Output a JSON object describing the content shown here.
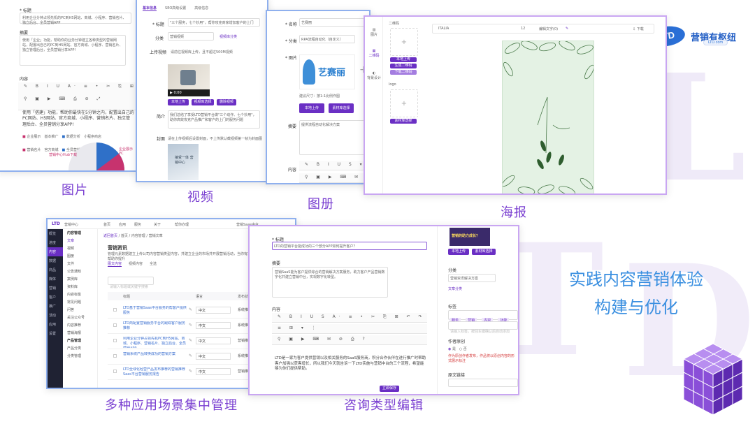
{
  "logo": {
    "mark": "LTD",
    "name": "营销有枢纽",
    "url": "LTD.com"
  },
  "tagline": {
    "line1": "实践内容营销体验",
    "line2": "构建与优化"
  },
  "captions": {
    "image": "图片",
    "video": "视频",
    "album": "图册",
    "poster": "海报",
    "scenarios": "多种应用场景集中管理",
    "consult": "咨询类型编辑"
  },
  "shot_image": {
    "title_label": "* 标题",
    "title_value": "利用企业分钟占领先机的PC到H5网站、商城、小程序、营销名片、独立后台、全员营销APP",
    "summary_label": "摘要",
    "summary_value": "使用「企业」功能，帮助你的业务分钟建立各种类型的营销网站，配置出自己的PC到H5网站、官方商城、小程序、营销名片、独立管理后台，全员营销分享APP!",
    "content_label": "内容",
    "content_value": "使用「搭建」功能，帮助你最快在5分钟之内，配置出自己的PC网站、H5网站、官方商城、小程序、营销名片、独立管理后台、全员营销分享APP!",
    "legend": [
      "企业展示",
      "基本推广",
      "数据分析",
      "小程序商店",
      "营销名片",
      "官方商城",
      "全员营销APP"
    ],
    "chart_label": "营销中心Hub下载",
    "chart_label2": "企业展示 PC"
  },
  "shot_video": {
    "tabs": [
      "基本信息",
      "SEO高级设置",
      "高级信息"
    ],
    "title_label": "* 标题",
    "title_value": "\"三个服务，七个妙用\"，帮你攻克商家增加客户的上门",
    "category_label": "分类",
    "category_value": "营销视频",
    "category_link": "视频库分类",
    "upload_label": "上传视频",
    "upload_hint": "请前往视频库上传，且不超过500M视频",
    "time": "0:00",
    "btn_local": "本地上传",
    "btn_library": "视频库选择",
    "btn_delete": "删除视频",
    "intro_label": "简介",
    "intro_value": "我们总结了享受LTD营销平台做\"三个动作、七个妙用\"，助你高效攻克产品推广和客户的上门的服务问题",
    "cover_label": "封面",
    "cover_hint": "请在上传视频后设置封面，不上传默认截视频第一帧为封面图",
    "thumb_text": "接受一体 营销中心"
  },
  "shot_album": {
    "name_label": "* 名称",
    "name_value": "艺赛丽",
    "category_label": "* 分类",
    "category_value": "RPA流程自动化（自定义）",
    "image_label": "* 图片",
    "logo_text": "艺赛丽",
    "size_hint": "建议尺寸：按1:1比例作图",
    "btn_local": "本地上传",
    "btn_library": "素材库选择",
    "desc_label": "摘要",
    "desc_value": "提供流程自动化解决方案",
    "content_label": "内容"
  },
  "shot_poster": {
    "side_items": [
      "图片",
      "二维码",
      "背景设计"
    ],
    "sub_label": "二维码",
    "logo_label": "logo",
    "btn_local": "本地上传",
    "btn_library": "素材库选择",
    "btn_qr": "生成二维码",
    "btn_download": "下载二维码",
    "font_value": "ITALIA",
    "size_value": "12",
    "font_label": "编辑文字(0)",
    "download_label": "下载"
  },
  "shot_manage": {
    "app_name": "营销中心",
    "nav": [
      "首页",
      "应用",
      "服务",
      "关于",
      "帮你办理"
    ],
    "account": "营销Saas中台",
    "sidebar": [
      "概览",
      "进度",
      "内容",
      "数据",
      "商品",
      "媒体",
      "营销",
      "客户",
      "推广",
      "活动",
      "应用",
      "设置"
    ],
    "subnav": [
      "内容管理",
      "文章",
      "视频",
      "图册",
      "文件",
      "公告通知",
      "案例库",
      "资料库",
      "内容标签",
      "常见问题",
      "问答",
      "关注公众号",
      "内容推荐",
      "营销海报",
      "产品管理",
      "产品分类",
      "分类管理"
    ],
    "breadcrumb": "首页 / 内容管理 / 营销文章",
    "back": "返回首页",
    "page_title": "营销资讯",
    "page_desc": "管理元素数据建立上传公司内容营销类型内容，并建立企业的市场并开展营销活动，当你有意向转化为营销成单时，可以帮助你提升",
    "filter_tabs": [
      "图文内容",
      "视频内容",
      "全选"
    ],
    "search_placeholder": "请输入标题或关键字搜索",
    "col_title": "标题",
    "col_lang": "语言",
    "col_status": "发布状态",
    "rows": [
      {
        "title": "LTD基于营销Saas中台服务的帮客户提供服务",
        "lang": "中文",
        "status": "系统推荐"
      },
      {
        "title": "LTD商配置营销服务平台的跟踪客户服务推荐",
        "lang": "中文",
        "status": "系统推荐"
      },
      {
        "title": "利用企业分钟占领先机PC到H5网站、商城、小程序、营销名片、独立后台、全员营销APP",
        "lang": "中文",
        "status": "营销推荐"
      },
      {
        "title": "营销系统产品转换成功的营销方案",
        "lang": "中文",
        "status": "系统推荐"
      },
      {
        "title": "LTD全球化经营产品发布推荐的营销推荐Saas平台营销服务报告",
        "lang": "中文",
        "status": "营销推荐"
      }
    ]
  },
  "shot_consult": {
    "title_label": "* 标题",
    "title_value": "LTD的营销平台能成功的三个部分APP如何提升客户？",
    "summary_label": "摘要",
    "summary_value": "营销SaaS能为客户提供综合的营销解决方案服务，助力客户产品营销数字化并建立营销中台，实现数字化转型。",
    "content_label": "内容",
    "content_value": "LTD是一家为客户提供营销以及相关服务的SaaS服务商，积分合作伙伴在进行推广时帮助客户加强以获客增长，所以我们今天就告诉一下LTD实施与营销中台的三个流程，希望能够为你们提供帮助。",
    "cover_text": "营销的助力成长？",
    "btn_local": "本地上传",
    "btn_library": "素材库选择",
    "category_label": "分类",
    "category_value": "营销资讯解决方案",
    "category_link": "文章分类",
    "tags_label": "标签",
    "tags": [
      "服务",
      "营销",
      "内容",
      "功能"
    ],
    "tag_hint": "请输入标签，按回车键确认后自动添加",
    "author_label": "作者原创",
    "author_yes": "是",
    "author_no": "否",
    "author_warning": "作为原创作者发布，作品将以原创内容的形式展示标注",
    "link_label": "原文链接",
    "save": "立即保存"
  }
}
